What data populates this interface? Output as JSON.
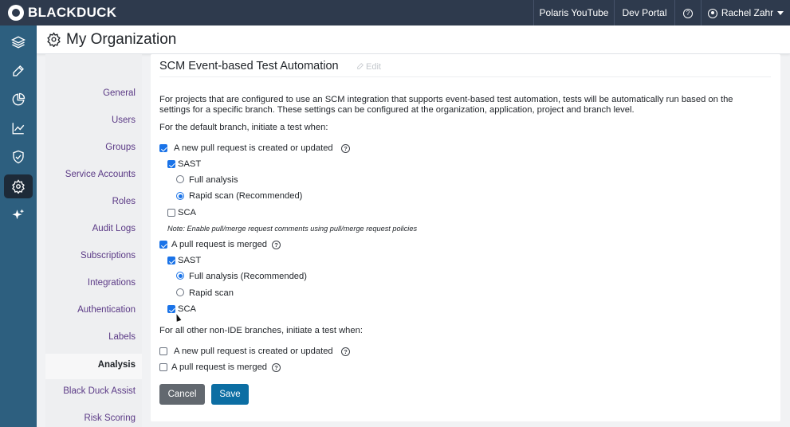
{
  "app": {
    "brand": "BLACKDUCK",
    "topnav": {
      "youtube": "Polaris YouTube",
      "devportal": "Dev Portal",
      "help": "?",
      "user": "Rachel Zahr"
    }
  },
  "rail": [
    "layers-icon",
    "pencil-icon",
    "pie-chart-icon",
    "trend-chart-icon",
    "shield-check-icon",
    "settings-icon",
    "sparkle-icon"
  ],
  "header": {
    "title": "My Organization"
  },
  "settings_nav": {
    "items": [
      {
        "label": "General"
      },
      {
        "label": "Users"
      },
      {
        "label": "Groups"
      },
      {
        "label": "Service Accounts"
      },
      {
        "label": "Roles"
      },
      {
        "label": "Audit Logs"
      },
      {
        "label": "Subscriptions"
      },
      {
        "label": "Integrations"
      },
      {
        "label": "Authentication"
      },
      {
        "label": "Labels"
      },
      {
        "label": "Analysis"
      },
      {
        "label": "Black Duck Assist"
      },
      {
        "label": "Risk Scoring"
      }
    ],
    "selected": "Analysis"
  },
  "section": {
    "title": "SCM Event-based Test Automation",
    "edit": "Edit",
    "description": "For projects that are configured to use an SCM integration that supports event-based test automation, tests will be automatically run based on the settings for a specific branch. These settings can be configured at the organization, application, project and branch level.",
    "default_branch_label": "For the default branch, initiate a test when:",
    "pr_created": {
      "label": "A new pull request is created or updated",
      "checked": true
    },
    "pr_created_sast": {
      "label": "SAST",
      "checked": true
    },
    "pr_created_full": {
      "label": "Full analysis",
      "selected": false
    },
    "pr_created_rapid": {
      "label": "Rapid scan (Recommended)",
      "selected": true
    },
    "pr_created_sca": {
      "label": "SCA",
      "checked": false
    },
    "note": "Note: Enable pull/merge request comments using pull/merge request policies",
    "pr_merged": {
      "label": "A pull request is merged",
      "checked": true
    },
    "pr_merged_sast": {
      "label": "SAST",
      "checked": true
    },
    "pr_merged_full": {
      "label": "Full analysis (Recommended)",
      "selected": true
    },
    "pr_merged_rapid": {
      "label": "Rapid scan",
      "selected": false
    },
    "pr_merged_sca": {
      "label": "SCA",
      "checked": true
    },
    "other_branches_label": "For all other non-IDE branches, initiate a test when:",
    "other_pr_created": {
      "label": "A new pull request is created or updated",
      "checked": false
    },
    "other_pr_merged": {
      "label": "A pull request is merged",
      "checked": false
    }
  },
  "buttons": {
    "cancel": "Cancel",
    "save": "Save"
  },
  "colors": {
    "topbar": "#2e3a4d",
    "rail": "#2d5f7f",
    "nav_link": "#5b3a86",
    "primary": "#0c6ea3",
    "checkbox": "#1a73e8"
  }
}
